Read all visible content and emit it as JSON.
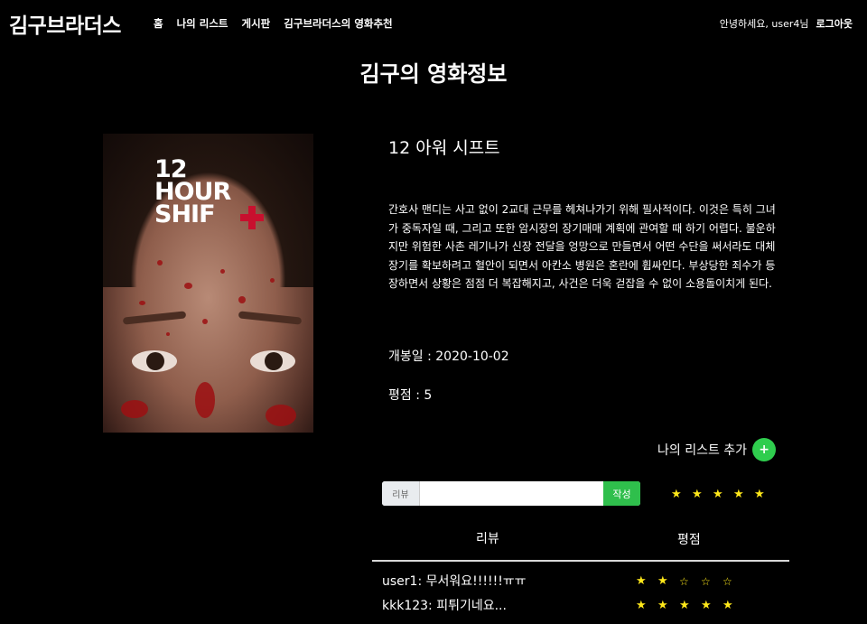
{
  "nav": {
    "brand": "김구브라더스",
    "links": [
      "홈",
      "나의 리스트",
      "게시판",
      "김구브라더스의 영화추천"
    ],
    "greeting": "안녕하세요, user4님",
    "logout": "로그아웃"
  },
  "page_title": "김구의 영화정보",
  "poster": {
    "text_line1": "12",
    "text_line2": "HOUR",
    "text_line3": "SHIF"
  },
  "movie": {
    "title": "12 아워 시프트",
    "synopsis": "간호사 맨디는 사고 없이 2교대 근무를 헤쳐나가기 위해 필사적이다. 이것은 특히 그녀가 중독자일 때, 그리고 또한 암시장의 장기매매 계획에 관여할 때 하기 어렵다. 불운하지만 위험한 사촌 레기나가 신장 전달을 엉망으로 만들면서 어떤 수단을 써서라도 대체장기를 확보하려고 혈안이 되면서 아칸소 병원은 혼란에 휩싸인다. 부상당한 죄수가 등장하면서 상황은 점점 더 복잡해지고, 사건은 더욱 걷잡을 수 없이 소용돌이치게 된다.",
    "release": "개봉일 : 2020-10-02",
    "rating": "평점 : 5"
  },
  "add_list": {
    "label": "나의 리스트 추가",
    "icon": "+"
  },
  "review_form": {
    "tag": "리뷰",
    "value": "",
    "placeholder": "",
    "submit": "작성",
    "stars": 5
  },
  "table": {
    "header_review": "리뷰",
    "header_rating": "평점",
    "rows": [
      {
        "text": "user1: 무서워요!!!!!!ㅠㅠ",
        "stars": 2
      },
      {
        "text": "kkk123: 피튀기네요...",
        "stars": 5
      }
    ]
  },
  "colors": {
    "accent_green": "#2fcd4e",
    "star_yellow": "#ffe81a",
    "background": "#000000"
  }
}
